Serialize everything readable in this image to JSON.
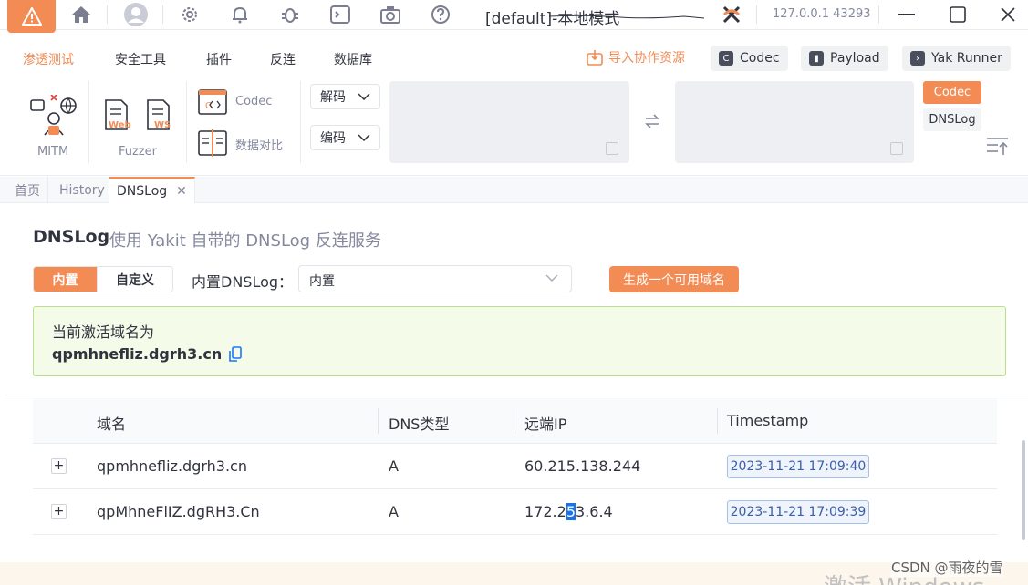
{
  "titlebar": {
    "title": "[default]-本地模式",
    "address": "127.0.0.1 43293"
  },
  "menu": {
    "items": [
      "渗透测试",
      "安全工具",
      "插件",
      "反连",
      "数据库"
    ],
    "import_label": "导入协作资源",
    "buttons": [
      "Codec",
      "Payload",
      "Yak Runner"
    ]
  },
  "tools": {
    "mitm_label": "MITM",
    "fuzzer_label": "Fuzzer",
    "web_label": "Web",
    "ws_label": "WS",
    "codec_label": "Codec",
    "diff_label": "数据对比",
    "decode_label": "解码",
    "encode_label": "编码",
    "side_tabs": [
      "Codec",
      "DNSLog"
    ]
  },
  "tabs": [
    "首页",
    "History",
    "DNSLog"
  ],
  "dnslog": {
    "title": "DNSLog",
    "subtitle": "使用 Yakit 自带的 DNSLog 反连服务",
    "mode_builtin": "内置",
    "mode_custom": "自定义",
    "builtin_label": "内置DNSLog：",
    "select_value": "内置",
    "gen_button": "生成一个可用域名",
    "active_label": "当前激活域名为",
    "active_domain": "qpmhnefliz.dgrh3.cn"
  },
  "table": {
    "headers": [
      "域名",
      "DNS类型",
      "远端IP",
      "Timestamp"
    ],
    "rows": [
      {
        "domain": "qpmhnefliz.dgrh3.cn",
        "type": "A",
        "ip": "60.215.138.244",
        "ip_pre": "",
        "ip_sel": "",
        "ip_post": "",
        "timestamp": "2023-11-21 17:09:40"
      },
      {
        "domain": "qpMhneFlIZ.dgRH3.Cn",
        "type": "A",
        "ip": "172.253.6.4",
        "ip_pre": "172.2",
        "ip_sel": "5",
        "ip_post": "3.6.4",
        "timestamp": "2023-11-21 17:09:39"
      }
    ]
  },
  "watermark": "CSDN @雨夜的雪",
  "activate_text": "激活 Windows",
  "colors": {
    "accent": "#f28b54",
    "success_bg": "#f4fbe9",
    "success_border": "#b9e08d",
    "badge_blue": "#3a5fa8"
  }
}
